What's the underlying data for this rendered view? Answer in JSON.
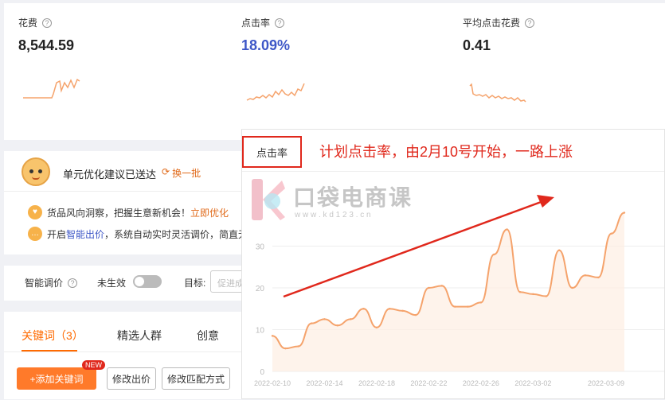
{
  "metrics": [
    {
      "label": "花费",
      "value": "8,544.59"
    },
    {
      "label": "点击率",
      "value": "18.09%"
    },
    {
      "label": "平均点击花费",
      "value": "0.41"
    }
  ],
  "suggestion": {
    "title": "单元优化建议已送达",
    "refresh": "换一批",
    "items": [
      {
        "text": "货品风向洞察，把握生意新机会！",
        "link": "立即优化"
      },
      {
        "text_prefix": "开启",
        "link": "智能出价",
        "text_suffix": "，系统自动实时灵活调价，简直无敌"
      }
    ]
  },
  "smart_bid": {
    "label": "智能调价",
    "status": "未生效",
    "target_label": "目标:",
    "target_placeholder": "促进成"
  },
  "tabs": [
    "关键词（3）",
    "精选人群",
    "创意"
  ],
  "toolbar": {
    "add_keyword": "+添加关键词",
    "new_badge": "NEW",
    "edit_bid": "修改出价",
    "edit_match": "修改匹配方式"
  },
  "chart_panel": {
    "tag": "点击率"
  },
  "annotation": "计划点击率，由2月10号开始，一路上涨",
  "watermark": {
    "brand": "口袋电商课",
    "url": "w w w . k d 1 2 3 . c n"
  },
  "colors": {
    "accent": "#ff7a2a",
    "annotation": "#e0281c",
    "line": "#f5a36c",
    "value_blue": "#3e57c7"
  },
  "chart_data": {
    "type": "area",
    "y_ticks": [
      "0",
      "10",
      "20",
      "30"
    ],
    "ylim": [
      0,
      40
    ],
    "x_ticks": [
      "2022-02-10",
      "2022-02-14",
      "2022-02-18",
      "2022-02-22",
      "2022-02-26",
      "2022-03-02",
      "2022-03-09"
    ],
    "x": [
      "02-10",
      "02-11",
      "02-12",
      "02-13",
      "02-14",
      "02-15",
      "02-16",
      "02-17",
      "02-18",
      "02-19",
      "02-20",
      "02-21",
      "02-22",
      "02-23",
      "02-24",
      "02-25",
      "02-26",
      "02-27",
      "02-28",
      "03-01",
      "03-02",
      "03-03",
      "03-04",
      "03-05",
      "03-06",
      "03-07",
      "03-08",
      "03-09"
    ],
    "values": [
      8.5,
      5.5,
      6,
      11.5,
      12.5,
      11,
      12.5,
      15,
      10.5,
      15,
      14.5,
      13.5,
      20,
      20.5,
      15.5,
      15.5,
      16.5,
      28,
      34,
      19,
      18.5,
      18,
      29,
      20,
      23,
      22.5,
      33,
      38
    ]
  }
}
